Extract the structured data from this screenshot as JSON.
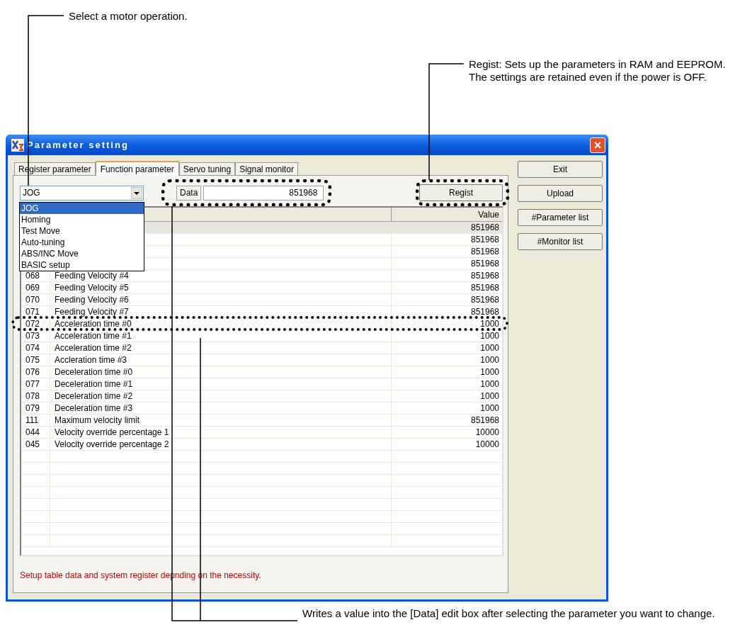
{
  "annotations": [
    {
      "kind": "top-left",
      "text": "Select a motor operation."
    },
    {
      "kind": "top-right",
      "text": "Regist: Sets up the parameters in RAM and EEPROM. The settings are retained even if the power is OFF."
    },
    {
      "kind": "bottom",
      "text": "Writes a value into the [Data] edit box after selecting the parameter you want to change."
    }
  ],
  "window": {
    "title": "Parameter setting",
    "close": "×"
  },
  "tabs": [
    {
      "label": "Register parameter",
      "selected": false
    },
    {
      "label": "Function parameter",
      "selected": true
    },
    {
      "label": "Servo tuning",
      "selected": false
    },
    {
      "label": "Signal monitor",
      "selected": false
    }
  ],
  "operation": {
    "value": "JOG",
    "options": [
      {
        "label": "JOG",
        "selected": true
      },
      {
        "label": "Homing",
        "selected": false
      },
      {
        "label": "Test Move",
        "selected": false
      },
      {
        "label": "Auto-tuning",
        "selected": false
      },
      {
        "label": "ABS/INC Move",
        "selected": false
      },
      {
        "label": "BASIC setup",
        "selected": false
      }
    ]
  },
  "data_field": {
    "label": "Data",
    "value": "851968"
  },
  "regist_button": "Regist",
  "table": {
    "columns": [
      "Value"
    ],
    "rows": [
      {
        "value": "851968",
        "selected": true
      },
      {
        "value": "851968",
        "selected": false
      },
      {
        "value": "851968",
        "selected": false
      },
      {
        "value": "851968",
        "selected": false
      },
      {
        "no": "068",
        "name": "Feeding Velocity #4",
        "value": "851968",
        "selected": false
      },
      {
        "no": "069",
        "name": "Feeding Velocity #5",
        "value": "851968",
        "selected": false
      },
      {
        "no": "070",
        "name": "Feeding Velocity #6",
        "value": "851968",
        "selected": false
      },
      {
        "no": "071",
        "name": "Feeding Velocity #7",
        "value": "851968",
        "selected": false
      },
      {
        "no": "072",
        "name": "Acceleration time #0",
        "value": "1000",
        "selected": false
      },
      {
        "no": "073",
        "name": "Acceleration time #1",
        "value": "1000",
        "selected": false
      },
      {
        "no": "074",
        "name": "Acceleration time #2",
        "value": "1000",
        "selected": false
      },
      {
        "no": "075",
        "name": "Accleration time #3",
        "value": "1000",
        "selected": false
      },
      {
        "no": "076",
        "name": "Deceleration time #0",
        "value": "1000",
        "selected": false
      },
      {
        "no": "077",
        "name": "Deceleration time #1",
        "value": "1000",
        "selected": false
      },
      {
        "no": "078",
        "name": "Deceleration time #2",
        "value": "1000",
        "selected": false
      },
      {
        "no": "079",
        "name": "Deceleration time #3",
        "value": "1000",
        "selected": false
      },
      {
        "no": "111",
        "name": "Maximum velocity limit",
        "value": "851968",
        "selected": false
      },
      {
        "no": "044",
        "name": "Velocity override percentage 1",
        "value": "10000",
        "selected": false
      },
      {
        "no": "045",
        "name": "Velocity override percentage 2",
        "value": "10000",
        "selected": false
      }
    ]
  },
  "status_message": "Setup table data and system register depnding on the necessity.",
  "side_buttons": [
    "Exit",
    "Upload",
    "#Parameter list",
    "#Monitor list"
  ]
}
